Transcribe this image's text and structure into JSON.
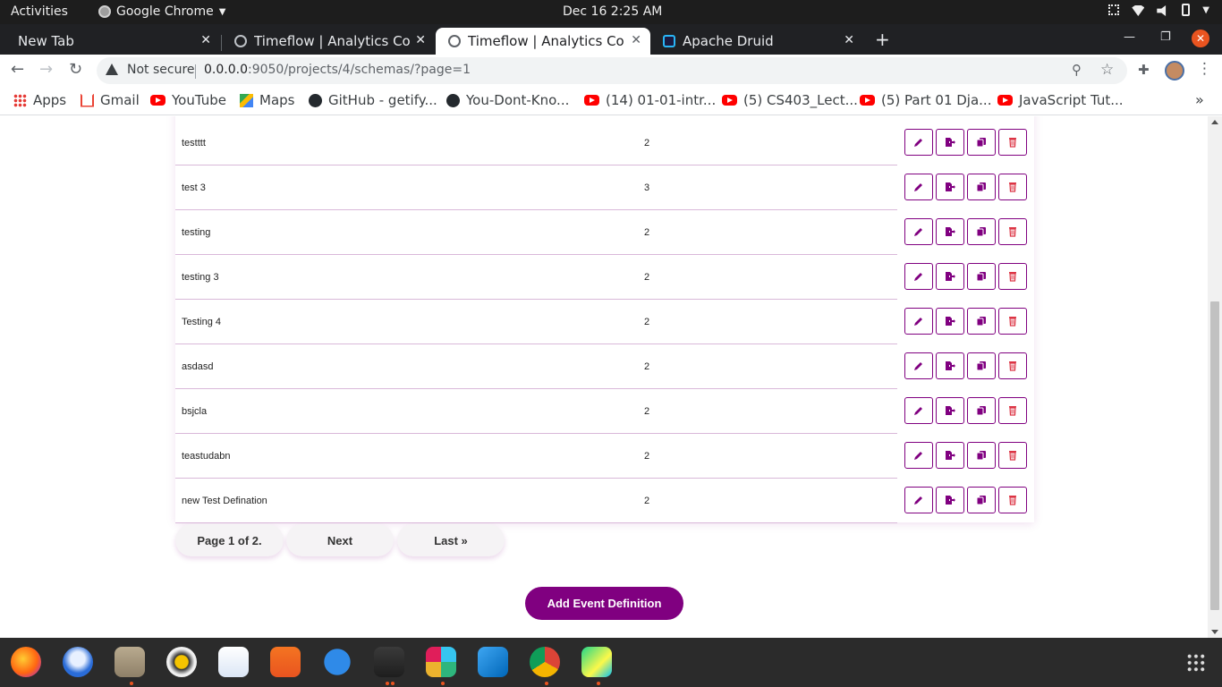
{
  "system": {
    "activities": "Activities",
    "app_name": "Google Chrome",
    "clock": "Dec 16  2:25 AM"
  },
  "browser": {
    "tabs": [
      {
        "title": "New Tab"
      },
      {
        "title": "Timeflow | Analytics Cons"
      },
      {
        "title": "Timeflow | Analytics Cons",
        "active": true
      },
      {
        "title": "Apache Druid"
      }
    ],
    "new_tab_symbol": "+",
    "security_label": "Not secure",
    "url_host": "0.0.0.0",
    "url_rest": ":9050/projects/4/schemas/?page=1",
    "bookmarks": [
      {
        "label": "Apps",
        "icon": "apps-grid-icon"
      },
      {
        "label": "Gmail",
        "icon": "gmail-icon"
      },
      {
        "label": "YouTube",
        "icon": "youtube-icon"
      },
      {
        "label": "Maps",
        "icon": "maps-icon"
      },
      {
        "label": "GitHub - getify...",
        "icon": "github-icon"
      },
      {
        "label": "You-Dont-Kno...",
        "icon": "github-icon"
      },
      {
        "label": "(14) 01-01-intr...",
        "icon": "youtube-icon"
      },
      {
        "label": "(5) CS403_Lect...",
        "icon": "youtube-icon"
      },
      {
        "label": "(5) Part 01 Dja...",
        "icon": "youtube-icon"
      },
      {
        "label": "JavaScript Tut...",
        "icon": "youtube-icon"
      }
    ]
  },
  "schemas": {
    "rows": [
      {
        "name": "testttt",
        "version": "2"
      },
      {
        "name": "test 3",
        "version": "3"
      },
      {
        "name": "testing",
        "version": "2"
      },
      {
        "name": "testing 3",
        "version": "2"
      },
      {
        "name": "Testing 4",
        "version": "2"
      },
      {
        "name": "asdasd",
        "version": "2"
      },
      {
        "name": "bsjcla",
        "version": "2"
      },
      {
        "name": "teastudabn",
        "version": "2"
      },
      {
        "name": "new Test Defination",
        "version": "2"
      }
    ],
    "actions": [
      "edit-icon",
      "export-file-icon",
      "copy-icon",
      "trash-icon"
    ]
  },
  "pagination": {
    "page_info": "Page 1 of 2.",
    "next": "Next",
    "last": "Last »"
  },
  "add_button": "Add Event Definition",
  "colors": {
    "accent": "#800080",
    "delete": "#dc3545",
    "close_window": "#e95420"
  },
  "dock": [
    "firefox-icon",
    "thunderbird-icon",
    "files-icon",
    "rhythmbox-icon",
    "libreoffice-writer-icon",
    "software-center-icon",
    "help-icon",
    "terminal-icon",
    "slack-icon",
    "vscode-icon",
    "chrome-icon",
    "pycharm-icon",
    "show-apps-icon"
  ]
}
